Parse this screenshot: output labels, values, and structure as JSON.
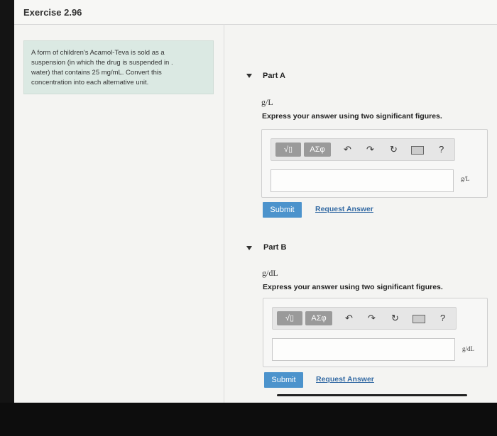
{
  "exercise": {
    "title": "Exercise 2.96"
  },
  "prompt": {
    "lines": [
      "A form of children's Acamol-Teva is sold as a",
      "suspension (in which the drug is suspended in .",
      "water) that contains 25 mg/mL. Convert this",
      "concentration into each alternative unit."
    ]
  },
  "parts": [
    {
      "header": "Part A",
      "unit": "g/L",
      "instruction": "Express your answer using two significant figures.",
      "toolbar": {
        "templates_label": "√▯",
        "symbols_label": "ΑΣφ",
        "help_label": "?"
      },
      "answer_value": "",
      "unit_tag": "g/L",
      "submit_label": "Submit",
      "request_label": "Request Answer"
    },
    {
      "header": "Part B",
      "unit": "g/dL",
      "instruction": "Express your answer using two significant figures.",
      "toolbar": {
        "templates_label": "√▯",
        "symbols_label": "ΑΣφ",
        "help_label": "?"
      },
      "answer_value": "",
      "unit_tag": "g/dL",
      "submit_label": "Submit",
      "request_label": "Request Answer"
    }
  ],
  "colors": {
    "submit": "#4c93cc",
    "link": "#356ba4",
    "prompt_bg": "#dbe9e3"
  }
}
